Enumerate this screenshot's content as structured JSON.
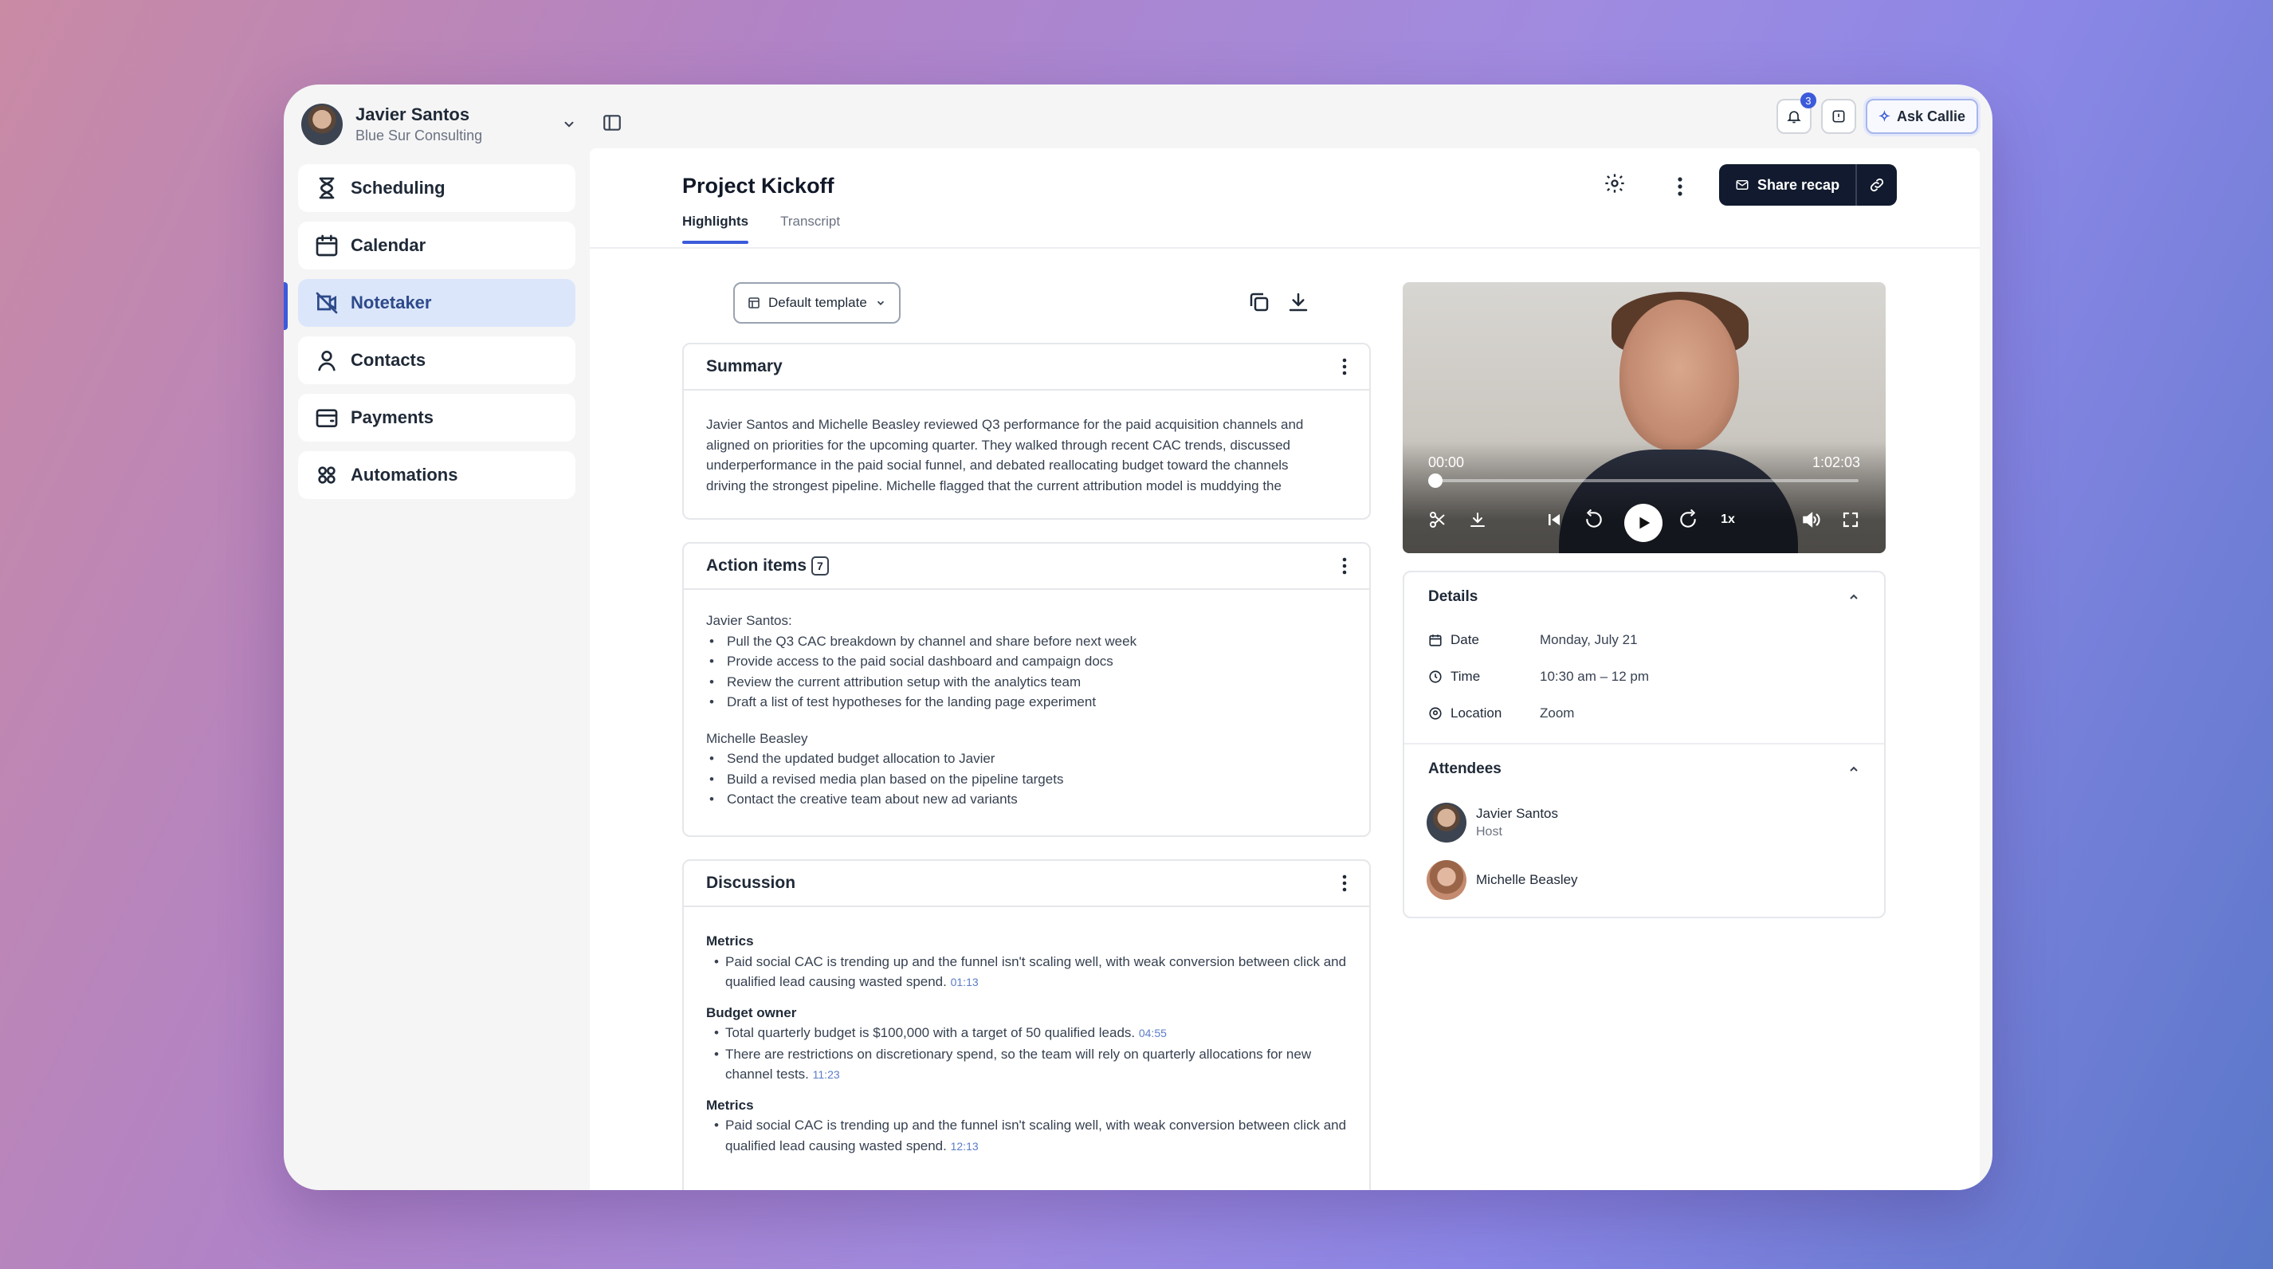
{
  "account": {
    "name": "Javier Santos",
    "org": "Blue Sur Consulting"
  },
  "nav": [
    {
      "label": "Scheduling",
      "icon": "hourglass-icon",
      "active": false
    },
    {
      "label": "Calendar",
      "icon": "calendar-icon",
      "active": false
    },
    {
      "label": "Notetaker",
      "icon": "notetaker-icon",
      "active": true
    },
    {
      "label": "Contacts",
      "icon": "contacts-icon",
      "active": false
    },
    {
      "label": "Payments",
      "icon": "wallet-icon",
      "active": false
    },
    {
      "label": "Automations",
      "icon": "automations-icon",
      "active": false
    }
  ],
  "topbar": {
    "notification_count": "3",
    "ask_label": "Ask Callie"
  },
  "page": {
    "title": "Project Kickoff",
    "tabs": [
      "Highlights",
      "Transcript"
    ],
    "active_tab": "Highlights",
    "share_label": "Share recap",
    "template_label": "Default template"
  },
  "summary": {
    "title": "Summary",
    "lines": [
      "Javier Santos and Michelle Beasley reviewed Q3 performance for the paid acquisition channels and",
      "aligned on priorities for the upcoming quarter. They walked through recent CAC trends, discussed",
      "underperformance in the paid social funnel, and debated reallocating budget toward the channels",
      "driving the strongest pipeline. Michelle flagged that the current attribution model is muddying the"
    ]
  },
  "action_items": {
    "title": "Action items",
    "count": "7",
    "groups": [
      {
        "owner": "Javier Santos:",
        "items": [
          "Pull the Q3 CAC breakdown by channel and share before next week",
          "Provide access to the paid social dashboard and campaign docs",
          "Review the current attribution setup with the analytics team",
          "Draft a list of test hypotheses for the landing page experiment"
        ]
      },
      {
        "owner": "Michelle Beasley",
        "items": [
          "Send the updated budget allocation to Javier",
          "Build a revised media plan based on the pipeline targets",
          "Contact the creative team about new ad variants"
        ]
      }
    ]
  },
  "discussion": {
    "title": "Discussion",
    "sections": [
      {
        "heading": "Metrics",
        "points": [
          {
            "text": "Paid social CAC is trending up and the funnel isn't scaling well, with weak conversion between click and qualified lead causing wasted spend.",
            "ts": "01:13"
          }
        ]
      },
      {
        "heading": "Budget owner",
        "points": [
          {
            "text": "Total quarterly budget is $100,000 with a target of 50 qualified leads.",
            "ts": "04:55"
          },
          {
            "text": "There are restrictions on discretionary spend, so the team will rely on quarterly allocations for new channel tests.",
            "ts": "11:23"
          }
        ]
      },
      {
        "heading": "Metrics",
        "points": [
          {
            "text": "Paid social CAC is trending up and the funnel isn't scaling well, with weak conversion between click and qualified lead causing wasted spend.",
            "ts": "12:13"
          }
        ]
      }
    ]
  },
  "video": {
    "current": "00:00",
    "duration": "1:02:03",
    "speed": "1x",
    "progress": 0
  },
  "details": {
    "title": "Details",
    "rows": [
      {
        "label": "Date",
        "value": "Monday, July 21",
        "icon": "calendar-icon"
      },
      {
        "label": "Time",
        "value": "10:30 am – 12 pm",
        "icon": "clock-icon"
      },
      {
        "label": "Location",
        "value": "Zoom",
        "icon": "location-pin-icon"
      }
    ]
  },
  "attendees": {
    "title": "Attendees",
    "people": [
      {
        "name": "Javier Santos",
        "role": "Host"
      },
      {
        "name": "Michelle Beasley",
        "role": ""
      }
    ]
  }
}
